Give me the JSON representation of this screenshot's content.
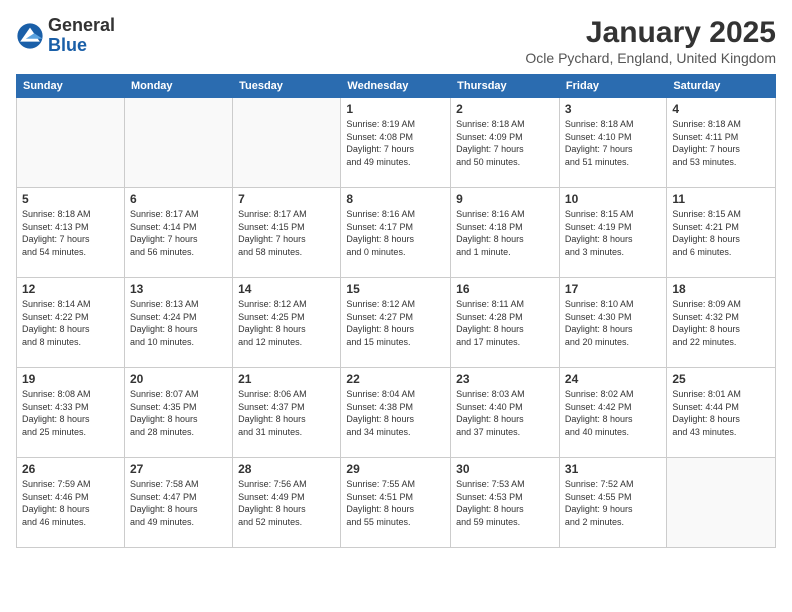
{
  "logo": {
    "general": "General",
    "blue": "Blue"
  },
  "title": "January 2025",
  "location": "Ocle Pychard, England, United Kingdom",
  "weekdays": [
    "Sunday",
    "Monday",
    "Tuesday",
    "Wednesday",
    "Thursday",
    "Friday",
    "Saturday"
  ],
  "weeks": [
    [
      {
        "day": "",
        "info": ""
      },
      {
        "day": "",
        "info": ""
      },
      {
        "day": "",
        "info": ""
      },
      {
        "day": "1",
        "info": "Sunrise: 8:19 AM\nSunset: 4:08 PM\nDaylight: 7 hours\nand 49 minutes."
      },
      {
        "day": "2",
        "info": "Sunrise: 8:18 AM\nSunset: 4:09 PM\nDaylight: 7 hours\nand 50 minutes."
      },
      {
        "day": "3",
        "info": "Sunrise: 8:18 AM\nSunset: 4:10 PM\nDaylight: 7 hours\nand 51 minutes."
      },
      {
        "day": "4",
        "info": "Sunrise: 8:18 AM\nSunset: 4:11 PM\nDaylight: 7 hours\nand 53 minutes."
      }
    ],
    [
      {
        "day": "5",
        "info": "Sunrise: 8:18 AM\nSunset: 4:13 PM\nDaylight: 7 hours\nand 54 minutes."
      },
      {
        "day": "6",
        "info": "Sunrise: 8:17 AM\nSunset: 4:14 PM\nDaylight: 7 hours\nand 56 minutes."
      },
      {
        "day": "7",
        "info": "Sunrise: 8:17 AM\nSunset: 4:15 PM\nDaylight: 7 hours\nand 58 minutes."
      },
      {
        "day": "8",
        "info": "Sunrise: 8:16 AM\nSunset: 4:17 PM\nDaylight: 8 hours\nand 0 minutes."
      },
      {
        "day": "9",
        "info": "Sunrise: 8:16 AM\nSunset: 4:18 PM\nDaylight: 8 hours\nand 1 minute."
      },
      {
        "day": "10",
        "info": "Sunrise: 8:15 AM\nSunset: 4:19 PM\nDaylight: 8 hours\nand 3 minutes."
      },
      {
        "day": "11",
        "info": "Sunrise: 8:15 AM\nSunset: 4:21 PM\nDaylight: 8 hours\nand 6 minutes."
      }
    ],
    [
      {
        "day": "12",
        "info": "Sunrise: 8:14 AM\nSunset: 4:22 PM\nDaylight: 8 hours\nand 8 minutes."
      },
      {
        "day": "13",
        "info": "Sunrise: 8:13 AM\nSunset: 4:24 PM\nDaylight: 8 hours\nand 10 minutes."
      },
      {
        "day": "14",
        "info": "Sunrise: 8:12 AM\nSunset: 4:25 PM\nDaylight: 8 hours\nand 12 minutes."
      },
      {
        "day": "15",
        "info": "Sunrise: 8:12 AM\nSunset: 4:27 PM\nDaylight: 8 hours\nand 15 minutes."
      },
      {
        "day": "16",
        "info": "Sunrise: 8:11 AM\nSunset: 4:28 PM\nDaylight: 8 hours\nand 17 minutes."
      },
      {
        "day": "17",
        "info": "Sunrise: 8:10 AM\nSunset: 4:30 PM\nDaylight: 8 hours\nand 20 minutes."
      },
      {
        "day": "18",
        "info": "Sunrise: 8:09 AM\nSunset: 4:32 PM\nDaylight: 8 hours\nand 22 minutes."
      }
    ],
    [
      {
        "day": "19",
        "info": "Sunrise: 8:08 AM\nSunset: 4:33 PM\nDaylight: 8 hours\nand 25 minutes."
      },
      {
        "day": "20",
        "info": "Sunrise: 8:07 AM\nSunset: 4:35 PM\nDaylight: 8 hours\nand 28 minutes."
      },
      {
        "day": "21",
        "info": "Sunrise: 8:06 AM\nSunset: 4:37 PM\nDaylight: 8 hours\nand 31 minutes."
      },
      {
        "day": "22",
        "info": "Sunrise: 8:04 AM\nSunset: 4:38 PM\nDaylight: 8 hours\nand 34 minutes."
      },
      {
        "day": "23",
        "info": "Sunrise: 8:03 AM\nSunset: 4:40 PM\nDaylight: 8 hours\nand 37 minutes."
      },
      {
        "day": "24",
        "info": "Sunrise: 8:02 AM\nSunset: 4:42 PM\nDaylight: 8 hours\nand 40 minutes."
      },
      {
        "day": "25",
        "info": "Sunrise: 8:01 AM\nSunset: 4:44 PM\nDaylight: 8 hours\nand 43 minutes."
      }
    ],
    [
      {
        "day": "26",
        "info": "Sunrise: 7:59 AM\nSunset: 4:46 PM\nDaylight: 8 hours\nand 46 minutes."
      },
      {
        "day": "27",
        "info": "Sunrise: 7:58 AM\nSunset: 4:47 PM\nDaylight: 8 hours\nand 49 minutes."
      },
      {
        "day": "28",
        "info": "Sunrise: 7:56 AM\nSunset: 4:49 PM\nDaylight: 8 hours\nand 52 minutes."
      },
      {
        "day": "29",
        "info": "Sunrise: 7:55 AM\nSunset: 4:51 PM\nDaylight: 8 hours\nand 55 minutes."
      },
      {
        "day": "30",
        "info": "Sunrise: 7:53 AM\nSunset: 4:53 PM\nDaylight: 8 hours\nand 59 minutes."
      },
      {
        "day": "31",
        "info": "Sunrise: 7:52 AM\nSunset: 4:55 PM\nDaylight: 9 hours\nand 2 minutes."
      },
      {
        "day": "",
        "info": ""
      }
    ]
  ]
}
